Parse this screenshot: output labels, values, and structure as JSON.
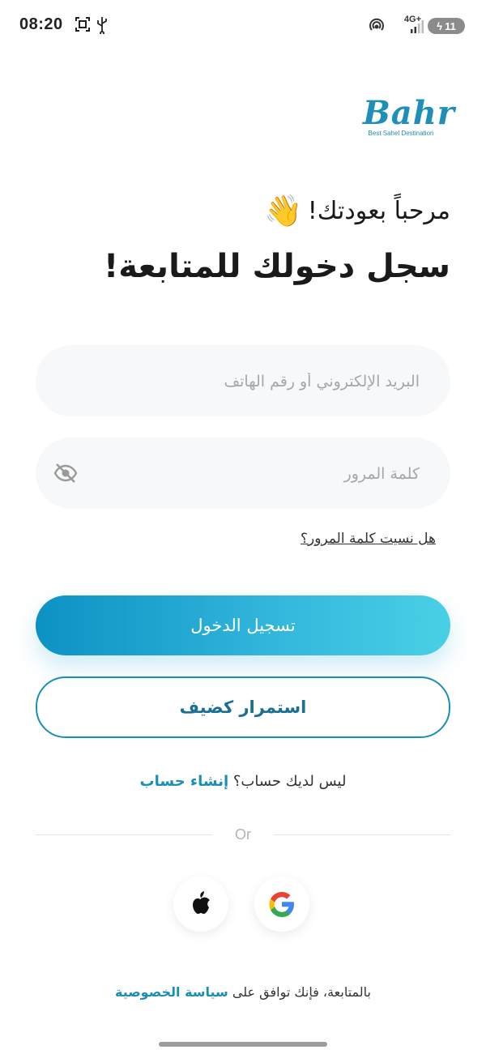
{
  "status_bar": {
    "time": "08:20",
    "battery": "11",
    "network": "4G+"
  },
  "logo": {
    "name": "Bahr",
    "tagline": "Best Sahel Destination"
  },
  "greeting": "مرحباً بعودتك!",
  "wave_emoji": "👋",
  "title": "سجل دخولك للمتابعة!",
  "form": {
    "email_placeholder": "البريد الإلكتروني أو رقم الهاتف",
    "password_placeholder": "كلمة المرور",
    "forgot_password": "هل نسيت كلمة المرور؟"
  },
  "buttons": {
    "login": "تسجيل الدخول",
    "guest": "استمرار كضيف"
  },
  "signup": {
    "prompt": "ليس لديك حساب؟",
    "link": "إنشاء حساب"
  },
  "divider_text": "Or",
  "social": [
    "apple-icon",
    "google-icon"
  ],
  "policy": {
    "prefix": "بالمتابعة، فإنك توافق على",
    "link": "سياسة الخصوصية"
  },
  "colors": {
    "accent": "#1a8fb4",
    "gradient_start": "#0c91c4",
    "gradient_end": "#49d0e6"
  }
}
